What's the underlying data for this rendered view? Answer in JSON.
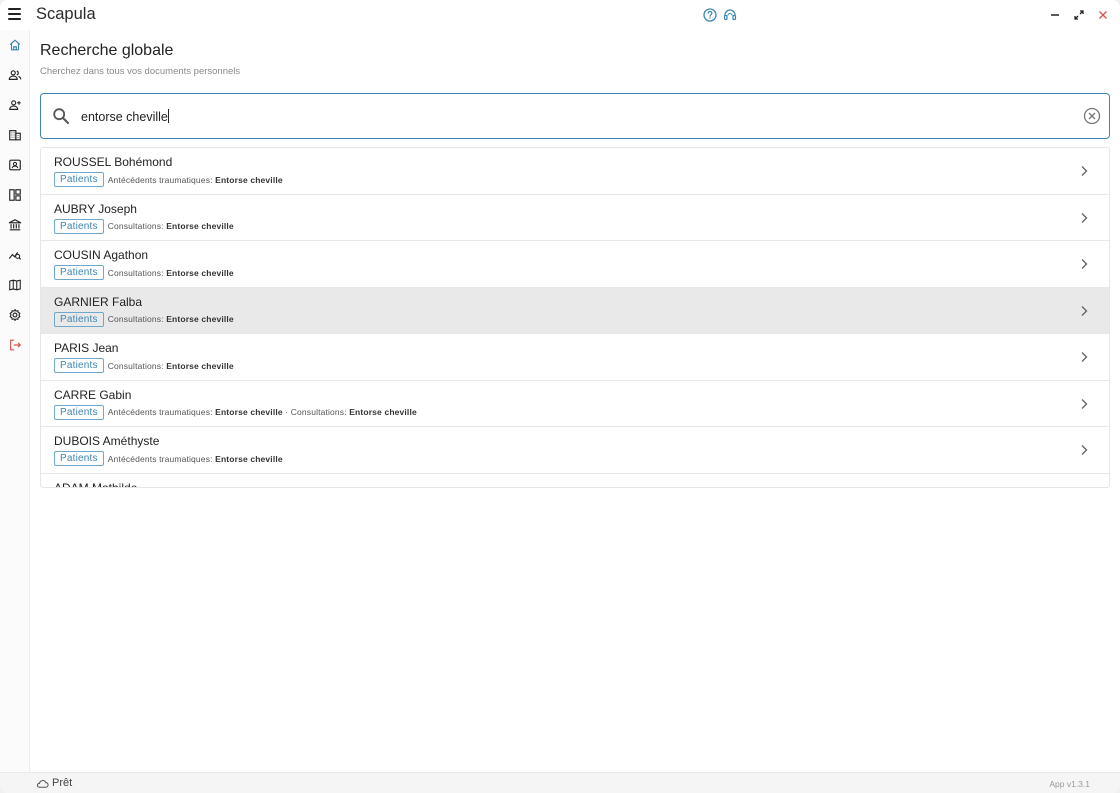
{
  "app": {
    "title": "Scapula"
  },
  "page": {
    "title": "Recherche globale",
    "subtitle": "Cherchez dans tous vos documents personnels"
  },
  "search": {
    "value": "entorse cheville"
  },
  "results": [
    {
      "name": "ROUSSEL Bohémond",
      "badge": "Patients",
      "matches": [
        {
          "label": "Antécédents traumatiques:",
          "value": "Entorse cheville"
        }
      ]
    },
    {
      "name": "AUBRY Joseph",
      "badge": "Patients",
      "matches": [
        {
          "label": "Consultations:",
          "value": "Entorse cheville"
        }
      ]
    },
    {
      "name": "COUSIN Agathon",
      "badge": "Patients",
      "matches": [
        {
          "label": "Consultations:",
          "value": "Entorse cheville"
        }
      ]
    },
    {
      "name": "GARNIER Falba",
      "badge": "Patients",
      "matches": [
        {
          "label": "Consultations:",
          "value": "Entorse cheville"
        }
      ]
    },
    {
      "name": "PARIS Jean",
      "badge": "Patients",
      "matches": [
        {
          "label": "Consultations:",
          "value": "Entorse cheville"
        }
      ]
    },
    {
      "name": "CARRE Gabin",
      "badge": "Patients",
      "matches": [
        {
          "label": "Antécédents traumatiques:",
          "value": "Entorse cheville"
        },
        {
          "label": "Consultations:",
          "value": "Entorse cheville"
        }
      ]
    },
    {
      "name": "DUBOIS Améthyste",
      "badge": "Patients",
      "matches": [
        {
          "label": "Antécédents traumatiques:",
          "value": "Entorse cheville"
        }
      ]
    },
    {
      "name": "ADAM Mathilde",
      "badge": "",
      "matches": []
    }
  ],
  "sidebar": {
    "items": [
      {
        "icon": "home-icon"
      },
      {
        "icon": "users-icon"
      },
      {
        "icon": "add-user-icon"
      },
      {
        "icon": "building-icon"
      },
      {
        "icon": "contact-card-icon"
      },
      {
        "icon": "dashboard-icon"
      },
      {
        "icon": "bank-icon"
      },
      {
        "icon": "analytics-search-icon"
      },
      {
        "icon": "map-icon"
      },
      {
        "icon": "settings-icon"
      },
      {
        "icon": "logout-icon"
      }
    ]
  },
  "status": {
    "text": "Prêt",
    "version": "App v1.3.1"
  },
  "colors": {
    "accent": "#3d86b3",
    "logout": "#d9534f",
    "highlight_row": "#e9e9e9"
  }
}
